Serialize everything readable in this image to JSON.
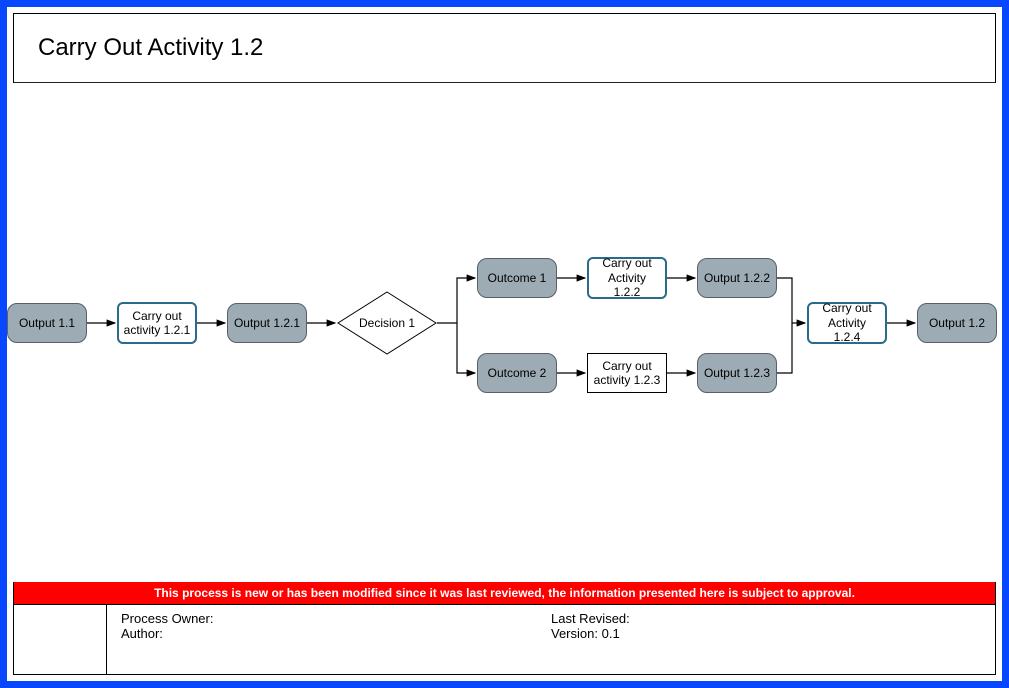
{
  "title": "Carry Out Activity 1.2",
  "nodes": {
    "output_1_1": "Output 1.1",
    "activity_1_2_1": "Carry out activity 1.2.1",
    "output_1_2_1": "Output 1.2.1",
    "decision_1": "Decision 1",
    "outcome_1": "Outcome 1",
    "outcome_2": "Outcome 2",
    "activity_1_2_2": "Carry out Activity 1.2.2",
    "activity_1_2_3": "Carry out activity 1.2.3",
    "output_1_2_2": "Output 1.2.2",
    "output_1_2_3": "Output 1.2.3",
    "activity_1_2_4": "Carry out Activity 1.2.4",
    "output_1_2": "Output 1.2"
  },
  "banner": "This process is new or has been modified since it was last reviewed, the information presented here is subject to approval.",
  "footer": {
    "process_owner_label": "Process Owner:",
    "process_owner_value": "",
    "author_label": "Author:",
    "author_value": "",
    "last_revised_label": "Last Revised:",
    "last_revised_value": "",
    "version_label": "Version:",
    "version_value": "0.1"
  },
  "chart_data": {
    "type": "flowchart",
    "title": "Carry Out Activity 1.2",
    "nodes": [
      {
        "id": "output_1_1",
        "label": "Output 1.1",
        "shape": "rounded-rect",
        "style": "output"
      },
      {
        "id": "activity_1_2_1",
        "label": "Carry out activity 1.2.1",
        "shape": "rounded-rect",
        "style": "activity-highlighted"
      },
      {
        "id": "output_1_2_1",
        "label": "Output 1.2.1",
        "shape": "rounded-rect",
        "style": "output"
      },
      {
        "id": "decision_1",
        "label": "Decision 1",
        "shape": "diamond",
        "style": "decision"
      },
      {
        "id": "outcome_1",
        "label": "Outcome 1",
        "shape": "rounded-rect",
        "style": "output"
      },
      {
        "id": "outcome_2",
        "label": "Outcome 2",
        "shape": "rounded-rect",
        "style": "output"
      },
      {
        "id": "activity_1_2_2",
        "label": "Carry out Activity 1.2.2",
        "shape": "rounded-rect",
        "style": "activity-highlighted"
      },
      {
        "id": "activity_1_2_3",
        "label": "Carry out activity 1.2.3",
        "shape": "rect",
        "style": "activity-plain"
      },
      {
        "id": "output_1_2_2",
        "label": "Output 1.2.2",
        "shape": "rounded-rect",
        "style": "output"
      },
      {
        "id": "output_1_2_3",
        "label": "Output 1.2.3",
        "shape": "rounded-rect",
        "style": "output"
      },
      {
        "id": "activity_1_2_4",
        "label": "Carry out Activity 1.2.4",
        "shape": "rounded-rect",
        "style": "activity-highlighted"
      },
      {
        "id": "output_1_2",
        "label": "Output 1.2",
        "shape": "rounded-rect",
        "style": "output"
      }
    ],
    "edges": [
      {
        "from": "output_1_1",
        "to": "activity_1_2_1"
      },
      {
        "from": "activity_1_2_1",
        "to": "output_1_2_1"
      },
      {
        "from": "output_1_2_1",
        "to": "decision_1"
      },
      {
        "from": "decision_1",
        "to": "outcome_1"
      },
      {
        "from": "decision_1",
        "to": "outcome_2"
      },
      {
        "from": "outcome_1",
        "to": "activity_1_2_2"
      },
      {
        "from": "outcome_2",
        "to": "activity_1_2_3"
      },
      {
        "from": "activity_1_2_2",
        "to": "output_1_2_2"
      },
      {
        "from": "activity_1_2_3",
        "to": "output_1_2_3"
      },
      {
        "from": "output_1_2_2",
        "to": "activity_1_2_4"
      },
      {
        "from": "output_1_2_3",
        "to": "activity_1_2_4"
      },
      {
        "from": "activity_1_2_4",
        "to": "output_1_2"
      }
    ]
  }
}
